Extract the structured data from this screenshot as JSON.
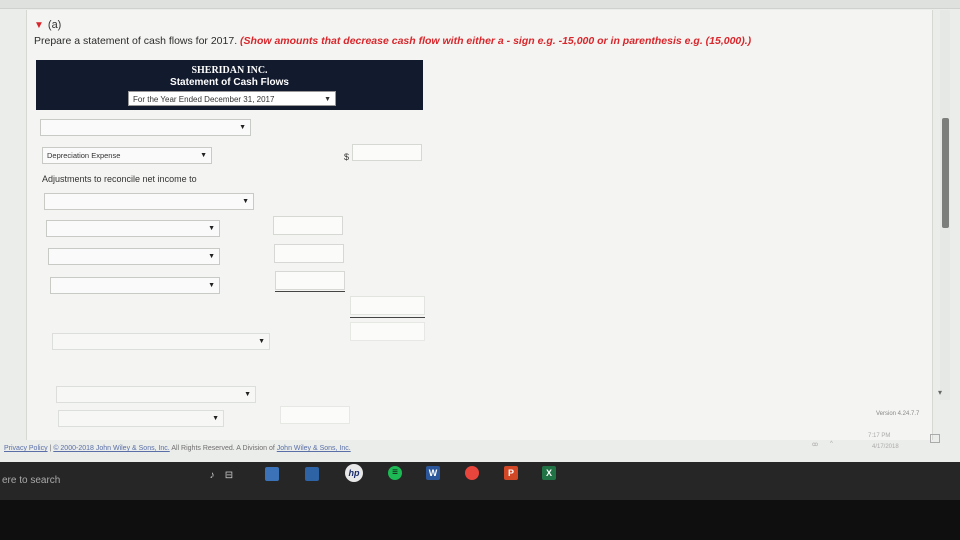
{
  "section": {
    "toggle": "(a)"
  },
  "instructions": {
    "prefix": "Prepare a statement of cash flows for 2017.",
    "note": "(Show amounts that decrease cash flow with either a - sign e.g. -15,000 or in parenthesis e.g. (15,000).)"
  },
  "statement": {
    "company": "SHERIDAN INC.",
    "title": "Statement of Cash Flows",
    "period": "For the Year Ended December 31, 2017"
  },
  "form": {
    "row1_select": "",
    "depreciation_select": "Depreciation Expense",
    "currency": "$",
    "adjustments_label": "Adjustments to reconcile net income to"
  },
  "scroll": {
    "arrow": "▾"
  },
  "version": "Version 4.24.7.7",
  "footer": {
    "privacy": "Privacy Policy",
    "sep": "|",
    "copyright": "© 2000-2018 John Wiley & Sons, Inc.",
    "rights": "All Rights Reserved. A Division of",
    "division": "John Wiley & Sons, Inc."
  },
  "taskbar": {
    "search_placeholder": "ere to search",
    "time": "7:17 PM",
    "date": "4/17/2018",
    "word_label": "W",
    "ppt_label": "P",
    "excel_label": "X",
    "hp_label": "hp"
  }
}
